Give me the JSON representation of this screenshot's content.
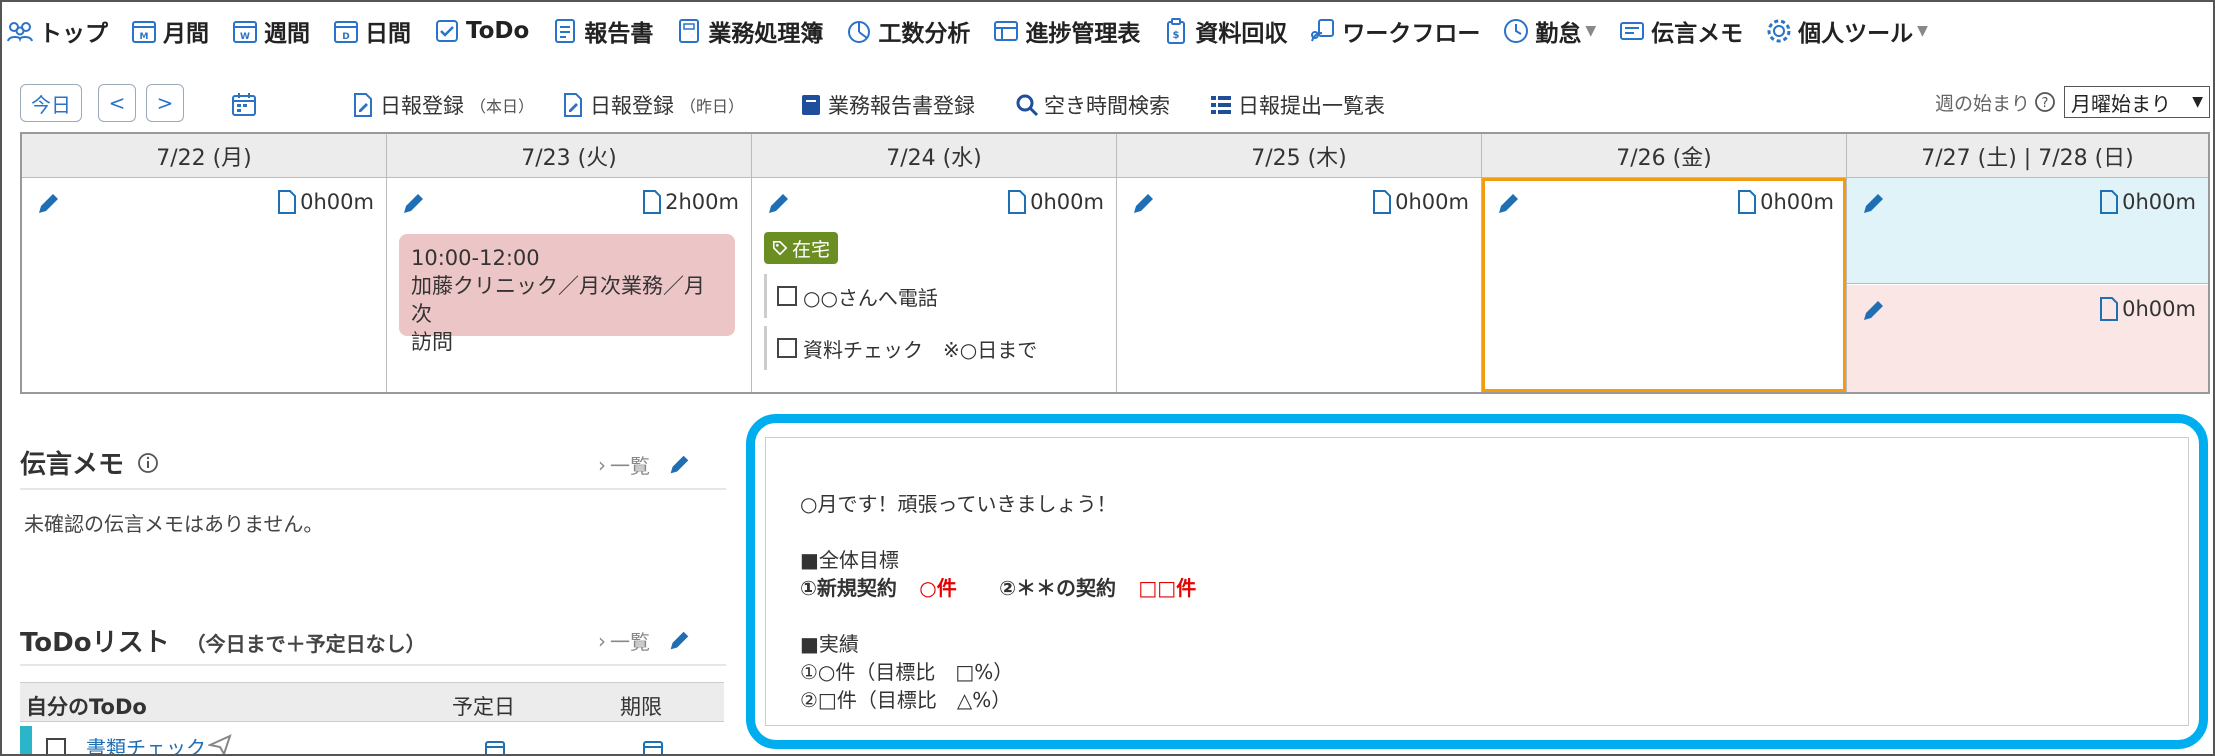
{
  "nav": [
    {
      "label": "トップ",
      "icon": "people-icon"
    },
    {
      "label": "月間",
      "icon": "calendar-month-icon"
    },
    {
      "label": "週間",
      "icon": "calendar-week-icon"
    },
    {
      "label": "日間",
      "icon": "calendar-day-icon"
    },
    {
      "label": "ToDo",
      "icon": "checkbox-icon"
    },
    {
      "label": "報告書",
      "icon": "report-icon"
    },
    {
      "label": "業務処理簿",
      "icon": "ledger-icon"
    },
    {
      "label": "工数分析",
      "icon": "pie-chart-icon"
    },
    {
      "label": "進捗管理表",
      "icon": "progress-table-icon"
    },
    {
      "label": "資料回収",
      "icon": "clipboard-icon"
    },
    {
      "label": "ワークフロー",
      "icon": "workflow-icon"
    },
    {
      "label": "勤怠",
      "icon": "clock-icon"
    },
    {
      "label": "伝言メモ",
      "icon": "memo-icon"
    },
    {
      "label": "個人ツール",
      "icon": "gear-icon"
    }
  ],
  "toolbar": {
    "today": "今日",
    "prev": "<",
    "next": ">",
    "daily_report_today": "日報登録",
    "daily_report_today_sub": "（本日）",
    "daily_report_yesterday": "日報登録",
    "daily_report_yesterday_sub": "（昨日）",
    "business_report": "業務報告書登録",
    "free_time_search": "空き時間検索",
    "daily_report_list": "日報提出一覧表",
    "week_start_label": "週の始まり",
    "week_start_value": "月曜始まり"
  },
  "calendar": {
    "days": [
      {
        "header": "7/22 (月)",
        "duration": "0h00m"
      },
      {
        "header": "7/23 (火)",
        "duration": "2h00m",
        "event_time": "10:00-12:00",
        "event_text_1": "加藤クリニック／月次業務／月次",
        "event_text_2": "訪問"
      },
      {
        "header": "7/24 (水)",
        "duration": "0h00m",
        "tag": "在宅",
        "todo1": "○○さんへ電話",
        "todo2": "資料チェック　※○日まで"
      },
      {
        "header": "7/25 (木)",
        "duration": "0h00m"
      },
      {
        "header": "7/26 (金)",
        "duration": "0h00m"
      },
      {
        "header": "7/27 (土) | 7/28 (日)",
        "duration_sat": "0h00m",
        "duration_sun": "0h00m"
      }
    ]
  },
  "memo": {
    "title": "伝言メモ",
    "list_link": "一覧",
    "empty": "未確認の伝言メモはありません。"
  },
  "todo": {
    "title": "ToDoリスト",
    "subtitle": "（今日まで＋予定日なし）",
    "list_link": "一覧",
    "col_own": "自分のToDo",
    "col_planned": "予定日",
    "col_deadline": "期限",
    "row1": "書類チェック"
  },
  "announcement": {
    "line1": "○月です！頑張っていきましょう！",
    "line2": "■全体目標",
    "line3_a": "①新規契約",
    "line3_b": "○件",
    "line3_c": "②＊＊の契約",
    "line3_d": "□□件",
    "line4": "■実績",
    "line5": "①○件（目標比　□%）",
    "line6": "②□件（目標比　△%）"
  },
  "colors": {
    "accent": "#2a73c8",
    "today_border": "#f39c12",
    "event_bg": "#ecc6c6",
    "saturday_bg": "#dff3f8",
    "sunday_bg": "#fbe6e6",
    "tag_bg": "#6b8e23",
    "highlight_border": "#00aeef"
  }
}
